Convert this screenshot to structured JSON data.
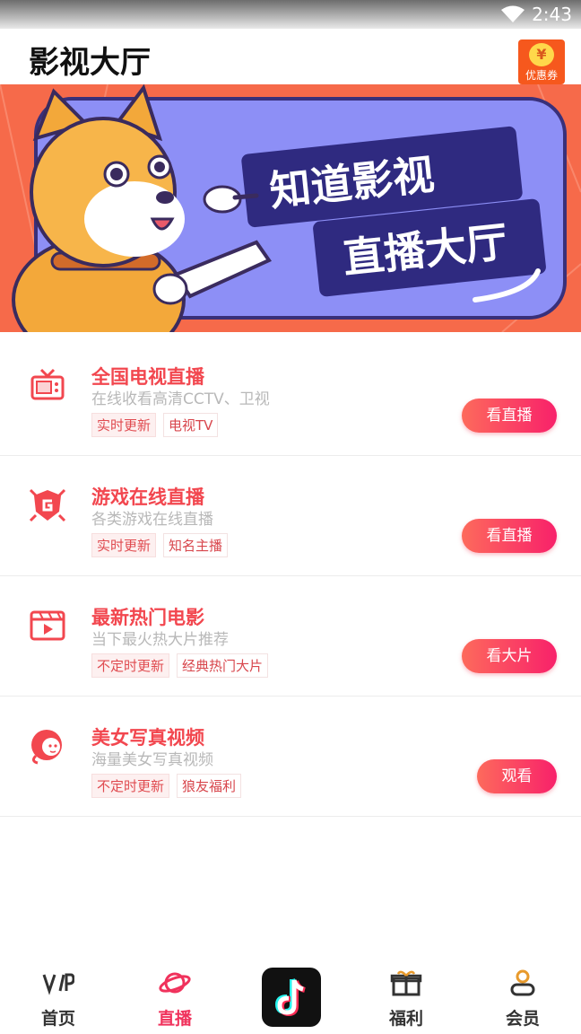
{
  "status": {
    "time": "2:43"
  },
  "header": {
    "title": "影视大厅",
    "coupon_label": "优惠券",
    "coupon_symbol": "¥"
  },
  "banner": {
    "line1": "知道影视",
    "line2": "直播大厅"
  },
  "items": [
    {
      "name": "全国电视直播",
      "desc": "在线收看高清CCTV、卫视",
      "tags": [
        "实时更新",
        "电视TV"
      ],
      "button": "看直播",
      "icon": "tv-icon"
    },
    {
      "name": "游戏在线直播",
      "desc": "各类游戏在线直播",
      "tags": [
        "实时更新",
        "知名主播"
      ],
      "button": "看直播",
      "icon": "game-shield-icon"
    },
    {
      "name": "最新热门电影",
      "desc": "当下最火热大片推荐",
      "tags": [
        "不定时更新",
        "经典热门大片"
      ],
      "button": "看大片",
      "icon": "movie-icon"
    },
    {
      "name": "美女写真视频",
      "desc": "海量美女写真视频",
      "tags": [
        "不定时更新",
        "狼友福利"
      ],
      "button": "观看",
      "icon": "girl-icon"
    }
  ],
  "tabbar": {
    "tabs": [
      {
        "label": "首页",
        "icon": "vip-icon"
      },
      {
        "label": "直播",
        "icon": "planet-icon"
      },
      {
        "label": "",
        "icon": "tiktok-icon"
      },
      {
        "label": "福利",
        "icon": "gift-icon"
      },
      {
        "label": "会员",
        "icon": "user-icon"
      }
    ]
  },
  "colors": {
    "accent": "#f2474f",
    "button_start": "#fd6a5c",
    "button_end": "#f8216a",
    "banner_bg": "#f66a4a",
    "banner_board": "#8d8ff6"
  }
}
